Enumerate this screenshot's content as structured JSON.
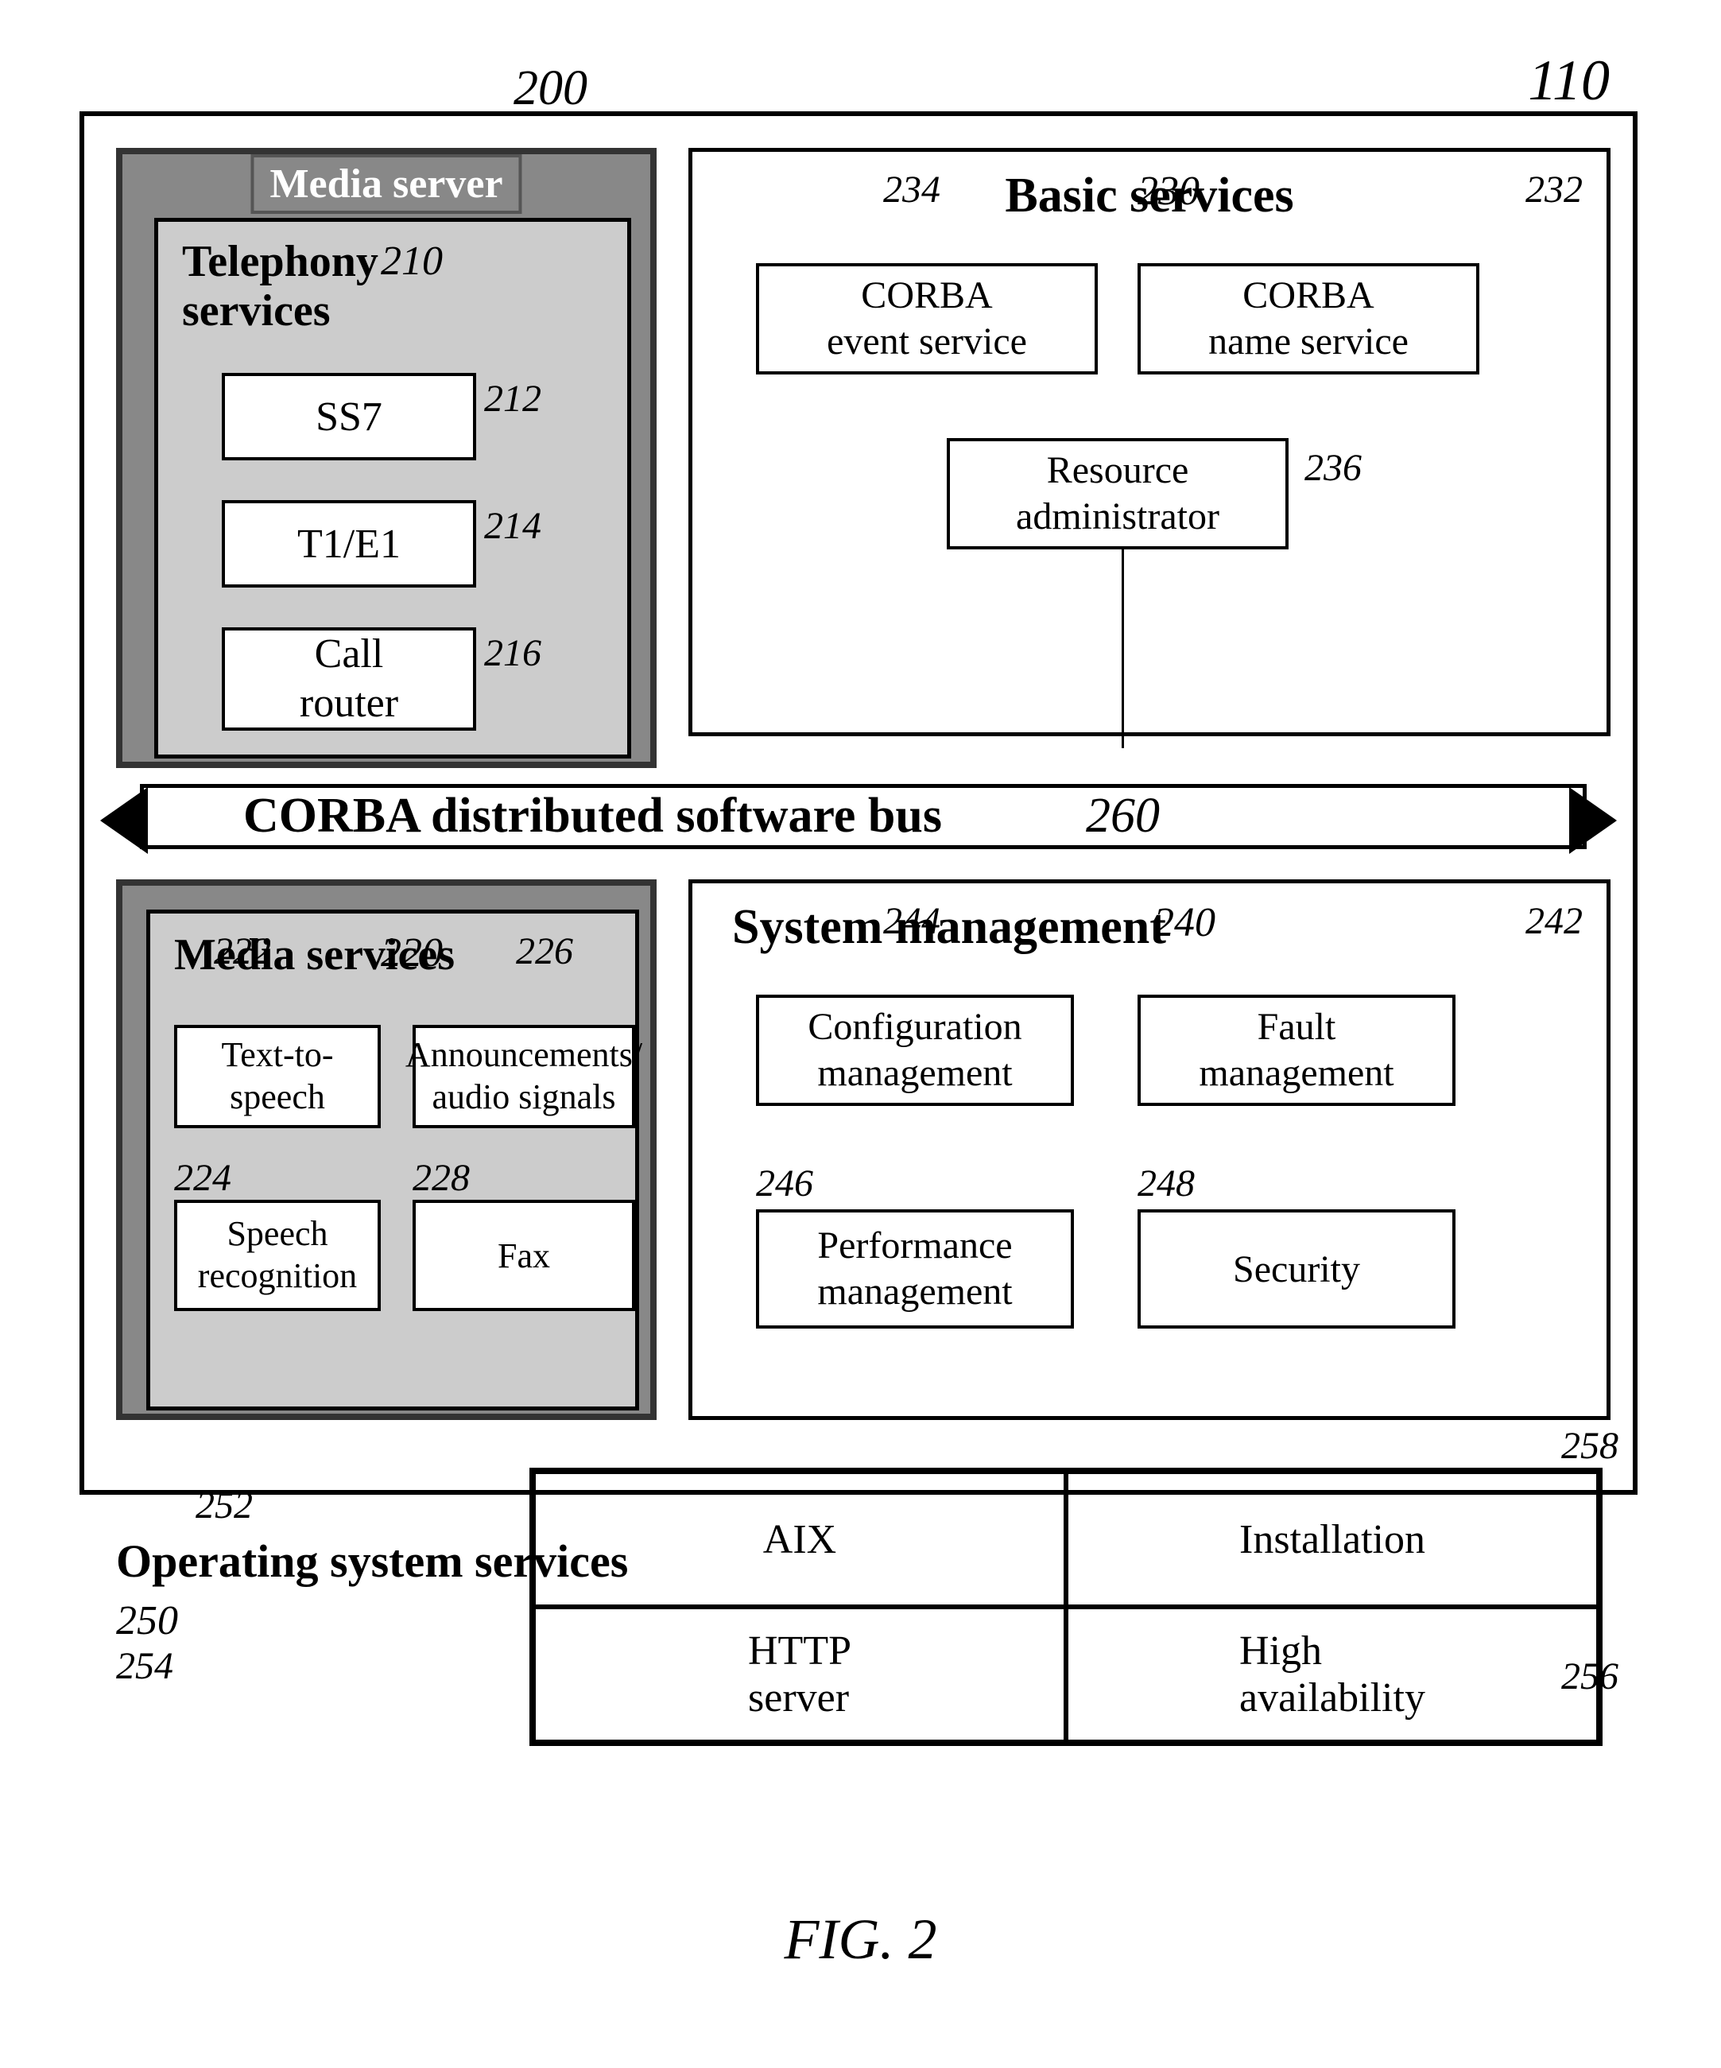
{
  "figure": {
    "number": "110",
    "caption": "FIG. 2",
    "main_label": "200"
  },
  "media_server": {
    "title": "Media server",
    "telephony": {
      "title": "Telephony\nservices",
      "label": "210",
      "ss7": {
        "label": "SS7",
        "id": "212"
      },
      "t1e1": {
        "label": "T1/E1",
        "id": "214"
      },
      "call_router": {
        "label": "Call\nrouter",
        "id": "216"
      }
    }
  },
  "basic_services": {
    "title": "Basic services",
    "label": "230",
    "label_234": "234",
    "label_232": "232",
    "corba_event": "CORBA\nevent service",
    "corba_name": "CORBA\nname service",
    "resource_admin": "Resource\nadministrator",
    "label_236": "236"
  },
  "corba_bus": {
    "title": "CORBA distributed software bus",
    "label": "260"
  },
  "media_services": {
    "title": "Media services",
    "label": "220",
    "label_222": "222",
    "label_226": "226",
    "tts": {
      "label": "Text-to-\nspeech"
    },
    "announcements": {
      "label": "Announcements/\naudio signals"
    },
    "label_224": "224",
    "label_228": "228",
    "speech_recognition": {
      "label": "Speech\nrecognition"
    },
    "fax": {
      "label": "Fax"
    }
  },
  "system_management": {
    "title": "System management",
    "label": "240",
    "label_244": "244",
    "label_242": "242",
    "config_mgmt": {
      "label": "Configuration\nmanagement"
    },
    "fault_mgmt": {
      "label": "Fault\nmanagement"
    },
    "label_246": "246",
    "label_248": "248",
    "perf_mgmt": {
      "label": "Performance\nmanagement"
    },
    "security": {
      "label": "Security"
    }
  },
  "os_services": {
    "title": "Operating system services",
    "label_250": "250",
    "label_252": "252",
    "label_254": "254",
    "aix": "AIX",
    "installation": "Installation",
    "http_server": "HTTP\nserver",
    "high_availability": "High\navailability",
    "label_258": "258",
    "label_256": "256"
  }
}
